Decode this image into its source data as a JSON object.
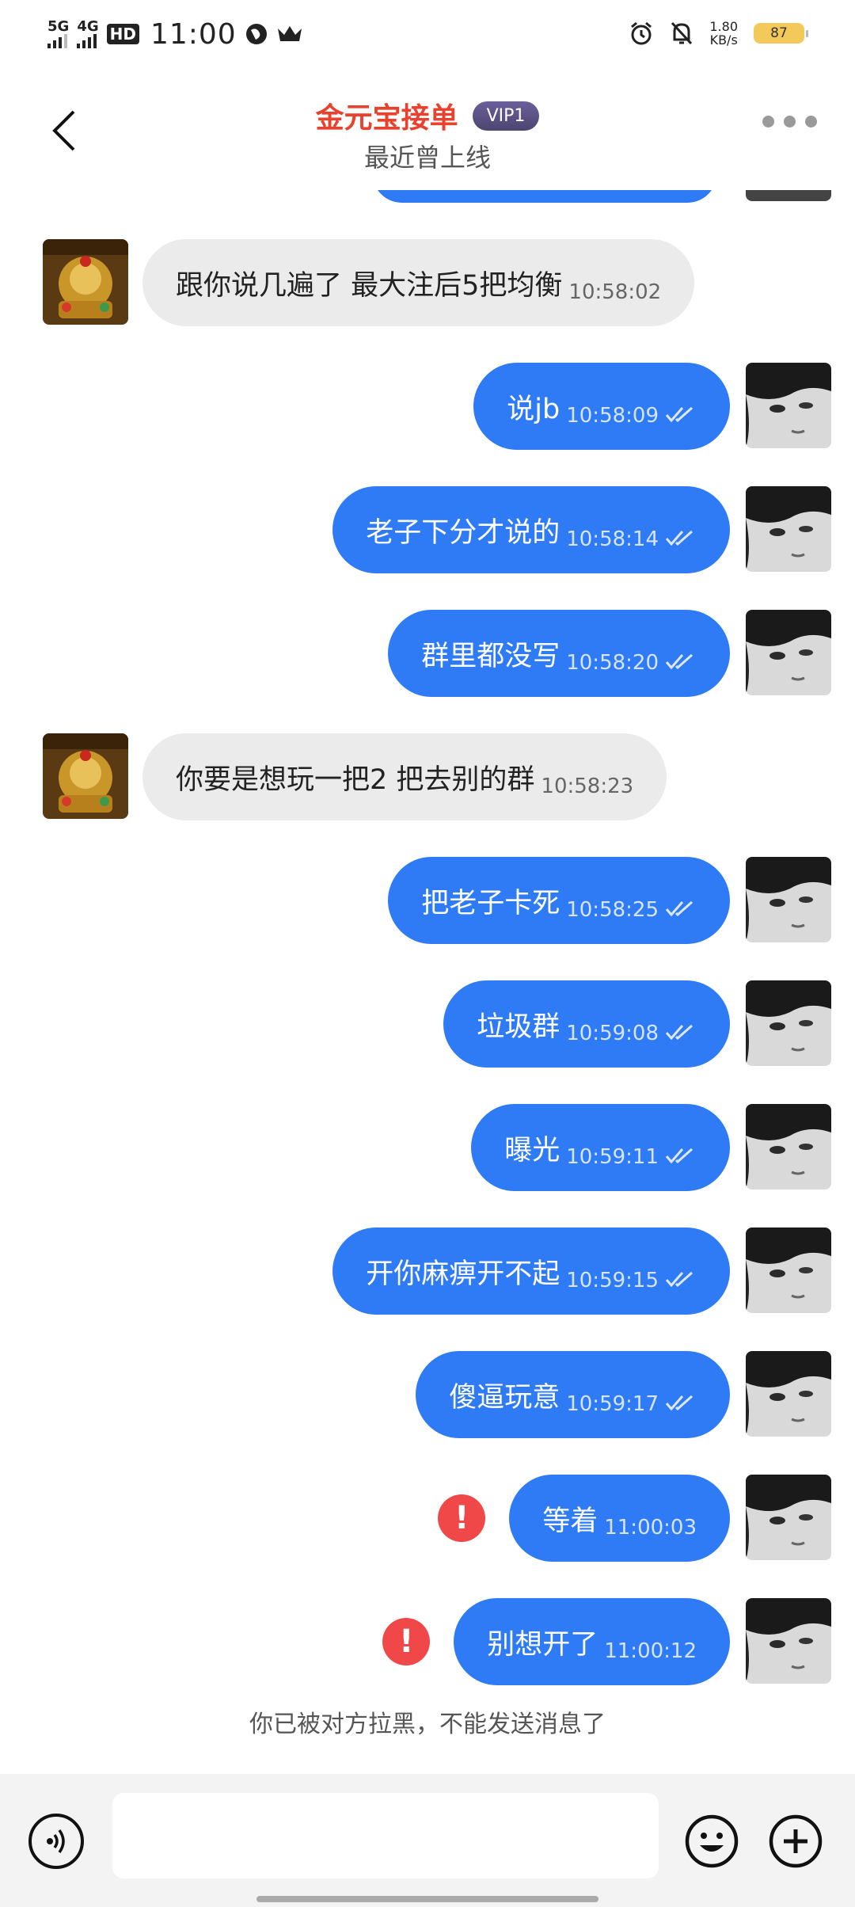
{
  "status_bar": {
    "signal_1": "5G",
    "signal_2": "4G",
    "hd": "HD",
    "time": "11:00",
    "speed_value": "1.80",
    "speed_unit": "KB/s",
    "battery": "87"
  },
  "header": {
    "contact_name": "金元宝接单",
    "vip": "VIP1",
    "subtitle": "最近曾上线"
  },
  "messages": [
    {
      "side": "in",
      "text": "跟你说几遍了 最大注后5把均衡",
      "time": "10:58:02"
    },
    {
      "side": "out",
      "text": "说jb",
      "time": "10:58:09",
      "status": "read"
    },
    {
      "side": "out",
      "text": "老子下分才说的",
      "time": "10:58:14",
      "status": "read"
    },
    {
      "side": "out",
      "text": "群里都没写",
      "time": "10:58:20",
      "status": "read"
    },
    {
      "side": "in",
      "text": "你要是想玩一把2 把去别的群",
      "time": "10:58:23"
    },
    {
      "side": "out",
      "text": "把老子卡死",
      "time": "10:58:25",
      "status": "read"
    },
    {
      "side": "out",
      "text": "垃圾群",
      "time": "10:59:08",
      "status": "read"
    },
    {
      "side": "out",
      "text": "曝光",
      "time": "10:59:11",
      "status": "read"
    },
    {
      "side": "out",
      "text": "开你麻痹开不起",
      "time": "10:59:15",
      "status": "read"
    },
    {
      "side": "out",
      "text": "傻逼玩意",
      "time": "10:59:17",
      "status": "read"
    },
    {
      "side": "out",
      "text": "等着",
      "time": "11:00:03",
      "status": "failed"
    },
    {
      "side": "out",
      "text": "别想开了",
      "time": "11:00:12",
      "status": "failed"
    }
  ],
  "blocked_note": "你已被对方拉黑，不能发送消息了",
  "input": {
    "value": "",
    "placeholder": ""
  },
  "colors": {
    "accent": "#2f7bf6",
    "name": "#e8422f",
    "incoming": "#ebebeb",
    "failed": "#f04848"
  }
}
